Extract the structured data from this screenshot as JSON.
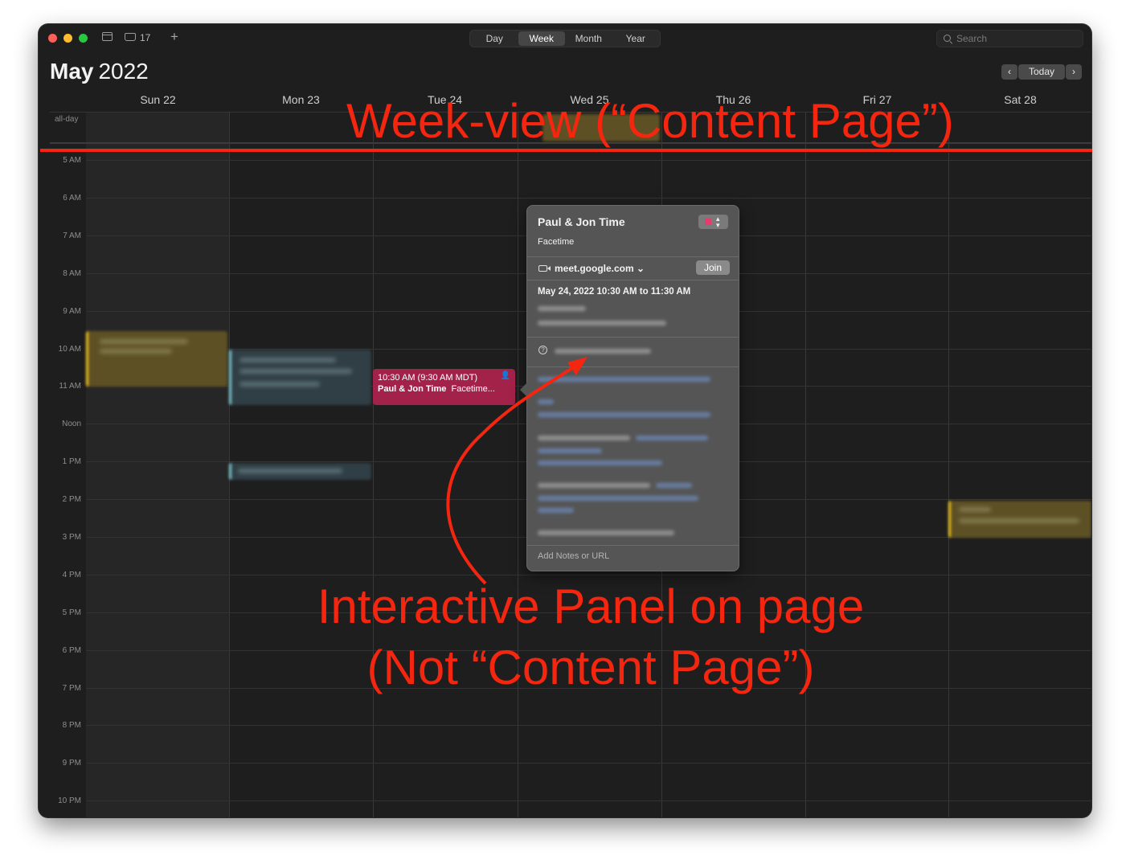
{
  "toolbar": {
    "inbox_count": "17",
    "views": [
      "Day",
      "Week",
      "Month",
      "Year"
    ],
    "active_view": "Week",
    "search_placeholder": "Search"
  },
  "header": {
    "month": "May",
    "year": "2022",
    "today_label": "Today"
  },
  "week": {
    "days": [
      "Sun 22",
      "Mon 23",
      "Tue 24",
      "Wed 25",
      "Thu 26",
      "Fri 27",
      "Sat 28"
    ],
    "allday_label": "all-day",
    "hours": [
      "5 AM",
      "6 AM",
      "7 AM",
      "8 AM",
      "9 AM",
      "10 AM",
      "11 AM",
      "Noon",
      "1 PM",
      "2 PM",
      "3 PM",
      "4 PM",
      "5 PM",
      "6 PM",
      "7 PM",
      "8 PM",
      "9 PM",
      "10 PM"
    ]
  },
  "event": {
    "time": "10:30 AM (9:30 AM MDT)",
    "title": "Paul & Jon Time",
    "location": "Facetime...",
    "color": "#a3224a"
  },
  "popover": {
    "title": "Paul & Jon Time",
    "subtitle": "Facetime",
    "link": "meet.google.com ⌄",
    "join_label": "Join",
    "datetime": "May 24, 2022  10:30 AM to 11:30 AM",
    "notes_placeholder": "Add Notes or URL",
    "calendar_color": "#e83a6d"
  },
  "annotations": {
    "top": "Week-view (“Content Page”)",
    "bottom_line1": "Interactive Panel on page",
    "bottom_line2": "(Not “Content Page”)",
    "color": "#f5260f"
  }
}
